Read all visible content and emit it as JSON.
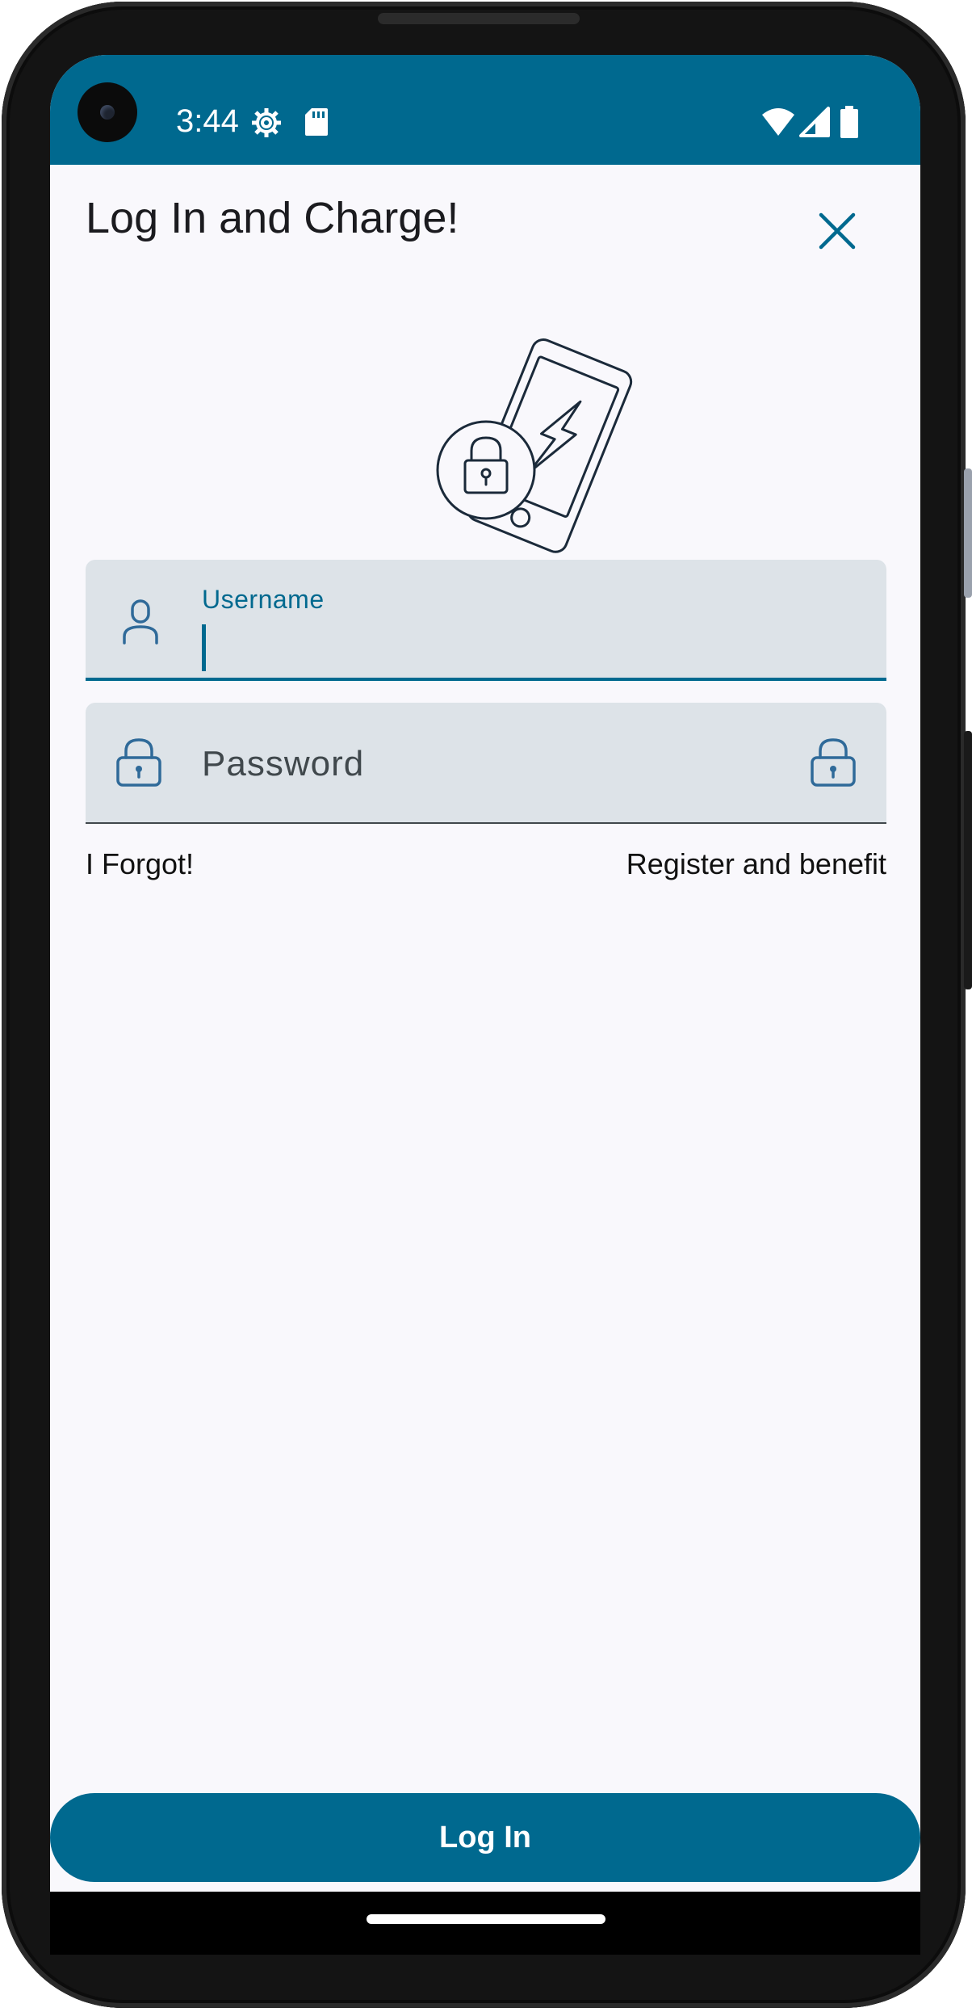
{
  "status_bar": {
    "time": "3:44",
    "background_color": "#00698f",
    "left_icons": [
      "settings-icon",
      "sd-card-icon"
    ],
    "right_icons": [
      "wifi-icon",
      "cellular-signal-icon",
      "battery-icon"
    ]
  },
  "header": {
    "title": "Log In and Charge!",
    "close_icon": "close-icon"
  },
  "illustration": {
    "icon": "phone-lock-charge-icon"
  },
  "form": {
    "username": {
      "label": "Username",
      "value": "",
      "icon": "person-icon",
      "focused": true
    },
    "password": {
      "placeholder": "Password",
      "value": "",
      "leading_icon": "lock-icon",
      "trailing_icon": "lock-icon"
    }
  },
  "links": {
    "forgot": "I Forgot!",
    "register": "Register and benefit"
  },
  "login_button": {
    "label": "Log In"
  },
  "colors": {
    "primary": "#00698f",
    "field_background": "#dde3e8",
    "screen_background": "#f9f8fc",
    "text": "#1b1b1f"
  }
}
